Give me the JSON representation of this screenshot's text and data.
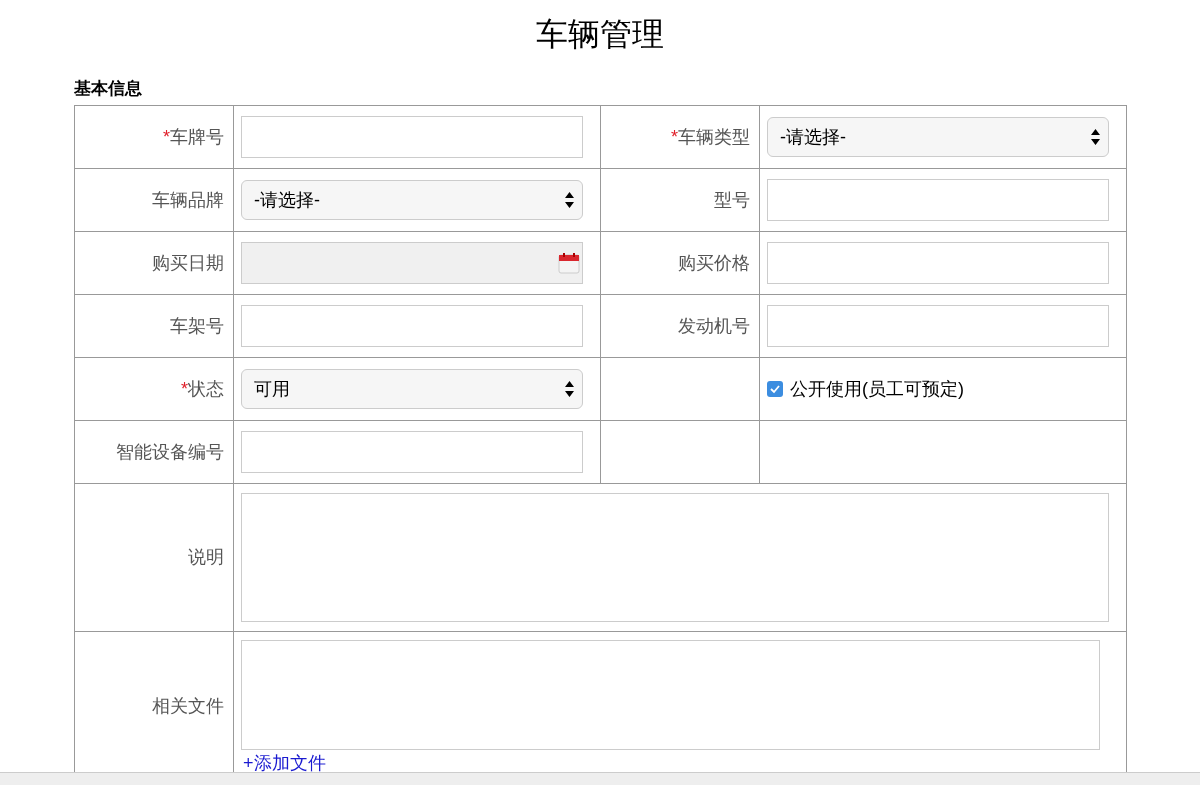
{
  "title": "车辆管理",
  "section": "基本信息",
  "rows": [
    [
      {
        "label": "车牌号",
        "mark": "*",
        "kind": "text"
      },
      {
        "label": "车辆类型",
        "mark": "*",
        "kind": "select",
        "value": "-请选择-"
      }
    ],
    [
      {
        "label": "车辆品牌",
        "kind": "select",
        "value": "-请选择-"
      },
      {
        "label": "型号",
        "kind": "text"
      }
    ],
    [
      {
        "label": "购买日期",
        "kind": "date",
        "disabled": true
      },
      {
        "label": "购买价格",
        "kind": "text"
      }
    ],
    [
      {
        "label": "车架号",
        "kind": "text"
      },
      {
        "label": "发动机号",
        "kind": "text"
      }
    ],
    [
      {
        "label": "状态",
        "mark": "*",
        "kind": "select",
        "value": "可用"
      },
      {
        "kind": "checkbox",
        "checked": true,
        "text": "公开使用(员工可预定)"
      }
    ],
    [
      {
        "label": "智能设备编号",
        "kind": "text"
      },
      {
        "kind": "empty"
      }
    ],
    [
      {
        "label": "说明",
        "kind": "textarea"
      }
    ],
    [
      {
        "label": "相关文件",
        "kind": "files",
        "link": "+添加文件"
      }
    ]
  ]
}
